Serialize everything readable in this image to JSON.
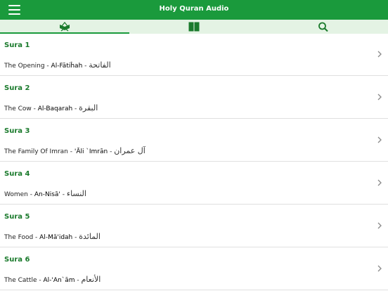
{
  "header": {
    "title": "Holy Quran Audio"
  },
  "tabs": [
    {
      "icon": "quran-stand-icon",
      "active": true
    },
    {
      "icon": "open-book-icon",
      "active": false
    },
    {
      "icon": "search-icon",
      "active": false
    }
  ],
  "colors": {
    "brand": "#1a9a3c",
    "tab_bg": "#e4f3e4",
    "sura_label": "#1a7a2c"
  },
  "suras": [
    {
      "label": "Sura 1",
      "english": "The Opening",
      "sep": " - ",
      "translit": "Al-Fātiĥah",
      "sep2": " - ",
      "arabic": "الفاتحة"
    },
    {
      "label": "Sura 2",
      "english": "The Cow",
      "sep": " - ",
      "translit": "Al-Baqarah",
      "sep2": " - ",
      "arabic": "البقرة"
    },
    {
      "label": "Sura 3",
      "english": "The Family Of Imran",
      "sep": " - ",
      "translit": "'Āli `Imrān",
      "sep2": " - ",
      "arabic": "آل عمران"
    },
    {
      "label": "Sura 4",
      "english": "Women",
      "sep": " - ",
      "translit": "An-Nisā'",
      "sep2": " - ",
      "arabic": "النساء"
    },
    {
      "label": "Sura 5",
      "english": "The Food",
      "sep": " - ",
      "translit": "Al-Mā'idah",
      "sep2": " - ",
      "arabic": "المائدة"
    },
    {
      "label": "Sura 6",
      "english": "The Cattle",
      "sep": " - ",
      "translit": "Al-'An`ām",
      "sep2": " - ",
      "arabic": "الأنعام"
    }
  ]
}
